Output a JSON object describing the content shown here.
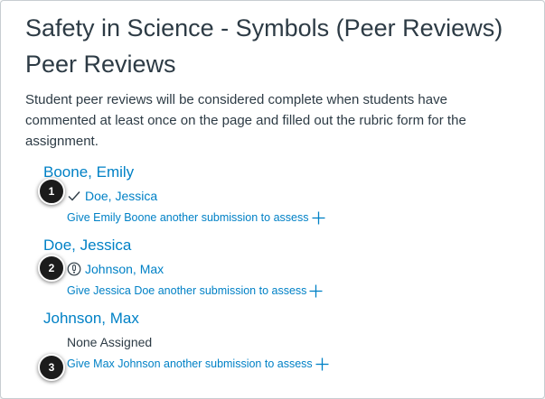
{
  "page": {
    "assignment_title": "Safety in Science - Symbols (Peer Reviews)",
    "section_title": "Peer Reviews",
    "description": "Student peer reviews will be considered complete when students have commented at least once on the page and filled out the rubric form for the assignment."
  },
  "reviewers": [
    {
      "name": "Boone, Emily",
      "assessment": "Doe, Jessica",
      "status": "check-icon",
      "give_label": "Give Emily Boone another submission to assess"
    },
    {
      "name": "Doe, Jessica",
      "assessment": "Johnson, Max",
      "status": "warning-circle-icon",
      "give_label": "Give Jessica Doe another submission to assess"
    },
    {
      "name": "Johnson, Max",
      "assessment": "None Assigned",
      "status": "none",
      "give_label": "Give Max Johnson another submission to assess"
    }
  ],
  "badges": [
    "1",
    "2",
    "3"
  ],
  "colors": {
    "link": "#0081c6",
    "text": "#2d3b45",
    "badge": "#1c1c1c"
  }
}
